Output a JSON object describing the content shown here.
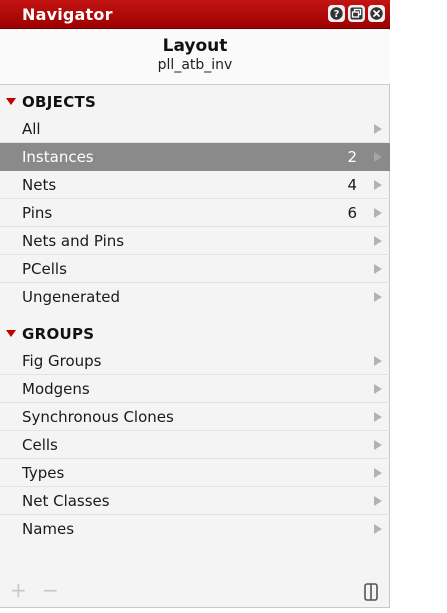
{
  "window": {
    "title": "Navigator",
    "buttons": [
      "help-icon",
      "restore-icon",
      "close-icon"
    ]
  },
  "header": {
    "title": "Layout",
    "subtitle": "pll_atb_inv"
  },
  "sections": [
    {
      "label": "OBJECTS",
      "items": [
        {
          "label": "All",
          "count": ""
        },
        {
          "label": "Instances",
          "count": "2",
          "selected": true
        },
        {
          "label": "Nets",
          "count": "4"
        },
        {
          "label": "Pins",
          "count": "6"
        },
        {
          "label": "Nets and Pins",
          "count": ""
        },
        {
          "label": "PCells",
          "count": ""
        },
        {
          "label": "Ungenerated",
          "count": ""
        }
      ]
    },
    {
      "label": "GROUPS",
      "items": [
        {
          "label": "Fig Groups",
          "count": ""
        },
        {
          "label": "Modgens",
          "count": ""
        },
        {
          "label": "Synchronous Clones",
          "count": ""
        },
        {
          "label": "Cells",
          "count": ""
        },
        {
          "label": "Types",
          "count": ""
        },
        {
          "label": "Net Classes",
          "count": ""
        },
        {
          "label": "Names",
          "count": ""
        }
      ]
    }
  ],
  "footer": {
    "add_label": "+",
    "remove_label": "−"
  },
  "colors": {
    "titlebar": "#b00808",
    "selected_row": "#8a8a8a",
    "section_triangle": "#c00000"
  }
}
